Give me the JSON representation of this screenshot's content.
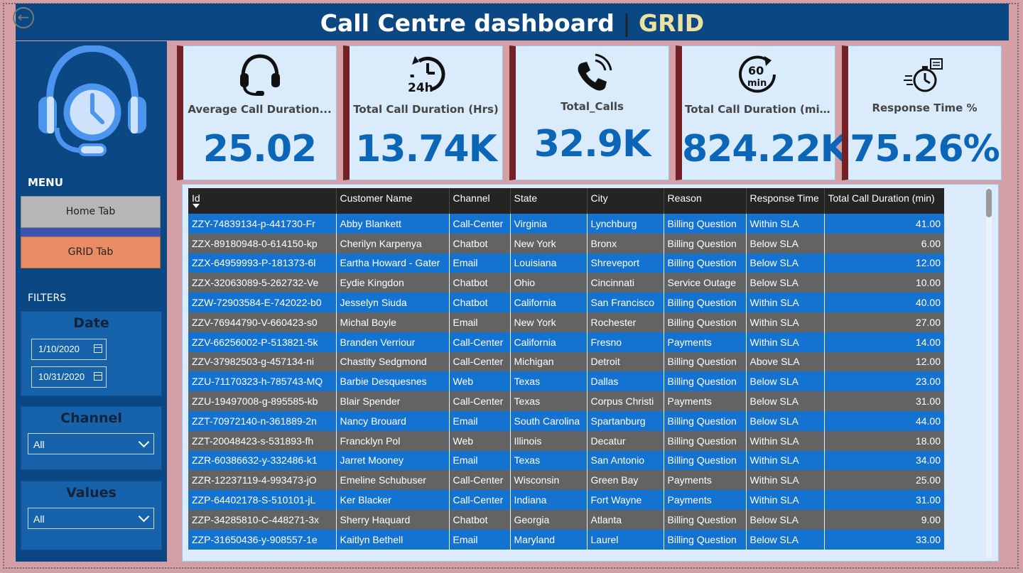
{
  "header": {
    "title": "Call Centre dashboard",
    "separator": "|",
    "subtitle": "GRID"
  },
  "nav": {
    "back_label": "←"
  },
  "sidebar": {
    "menu_label": "MENU",
    "home_tab": "Home Tab",
    "grid_tab": "GRID Tab",
    "filters_label": "FILTERS",
    "date": {
      "title": "Date",
      "start": "1/10/2020",
      "end": "10/31/2020"
    },
    "channel": {
      "title": "Channel",
      "selected": "All"
    },
    "values": {
      "title": "Values",
      "selected": "All"
    }
  },
  "kpis": [
    {
      "icon": "headset-icon",
      "title": "Average Call Duration...",
      "value": "25.02"
    },
    {
      "icon": "clock-24h-icon",
      "title": "Total Call Duration (Hrs)",
      "value": "13.74K"
    },
    {
      "icon": "phone-ringing-icon",
      "title": "Total_Calls",
      "value": "32.9K"
    },
    {
      "icon": "timer-60min-icon",
      "title": "Total Call Duration (min)",
      "value": "824.22K"
    },
    {
      "icon": "stopwatch-icon",
      "title": "Response Time %",
      "value": "75.26%"
    }
  ],
  "table": {
    "columns": [
      "Id",
      "Customer Name",
      "Channel",
      "State",
      "City",
      "Reason",
      "Response Time",
      "Total Call Duration (min)"
    ],
    "rows": [
      [
        "ZZY-74839134-p-441730-Fr",
        "Abby Blankett",
        "Call-Center",
        "Virginia",
        "Lynchburg",
        "Billing Question",
        "Within SLA",
        "41.00"
      ],
      [
        "ZZX-89180948-0-614150-kp",
        "Cherilyn Karpenya",
        "Chatbot",
        "New York",
        "Bronx",
        "Billing Question",
        "Below SLA",
        "6.00"
      ],
      [
        "ZZX-64959993-P-181373-6l",
        "Eartha Howard - Gater",
        "Email",
        "Louisiana",
        "Shreveport",
        "Billing Question",
        "Below SLA",
        "12.00"
      ],
      [
        "ZZX-32063089-5-262732-Ve",
        "Eydie Kingdon",
        "Chatbot",
        "Ohio",
        "Cincinnati",
        "Service Outage",
        "Below SLA",
        "10.00"
      ],
      [
        "ZZW-72903584-E-742022-b0",
        "Jesselyn Siuda",
        "Chatbot",
        "California",
        "San Francisco",
        "Billing Question",
        "Within SLA",
        "40.00"
      ],
      [
        "ZZV-76944790-V-660423-s0",
        "Michal Boyle",
        "Email",
        "New York",
        "Rochester",
        "Billing Question",
        "Within SLA",
        "27.00"
      ],
      [
        "ZZV-66256002-P-513821-5k",
        "Branden Verriour",
        "Call-Center",
        "California",
        "Fresno",
        "Payments",
        "Within SLA",
        "14.00"
      ],
      [
        "ZZV-37982503-g-457134-ni",
        "Chastity Sedgmond",
        "Call-Center",
        "Michigan",
        "Detroit",
        "Billing Question",
        "Above SLA",
        "12.00"
      ],
      [
        "ZZU-71170323-h-785743-MQ",
        "Barbie Desquesnes",
        "Web",
        "Texas",
        "Dallas",
        "Billing Question",
        "Below SLA",
        "23.00"
      ],
      [
        "ZZU-19497008-g-895585-kb",
        "Blair Spender",
        "Call-Center",
        "Texas",
        "Corpus Christi",
        "Payments",
        "Below SLA",
        "31.00"
      ],
      [
        "ZZT-70972140-n-361889-2n",
        "Nancy Brouard",
        "Email",
        "South Carolina",
        "Spartanburg",
        "Billing Question",
        "Below SLA",
        "44.00"
      ],
      [
        "ZZT-20048423-s-531893-fh",
        "Francklyn Pol",
        "Web",
        "Illinois",
        "Decatur",
        "Billing Question",
        "Within SLA",
        "18.00"
      ],
      [
        "ZZR-60386632-y-332486-k1",
        "Jarret Mooney",
        "Email",
        "Texas",
        "San Antonio",
        "Billing Question",
        "Within SLA",
        "34.00"
      ],
      [
        "ZZR-12237119-4-993473-jO",
        "Emeline Schubuser",
        "Call-Center",
        "Wisconsin",
        "Green Bay",
        "Payments",
        "Within SLA",
        "25.00"
      ],
      [
        "ZZP-64402178-S-510101-jL",
        "Ker Blacker",
        "Call-Center",
        "Indiana",
        "Fort Wayne",
        "Payments",
        "Within SLA",
        "31.00"
      ],
      [
        "ZZP-34285810-C-448271-3x",
        "Sherry Haquard",
        "Chatbot",
        "Georgia",
        "Atlanta",
        "Billing Question",
        "Below SLA",
        "9.00"
      ],
      [
        "ZZP-31650436-y-908557-1e",
        "Kaitlyn Bethell",
        "Email",
        "Maryland",
        "Laurel",
        "Billing Question",
        "Below SLA",
        "33.00"
      ]
    ]
  }
}
